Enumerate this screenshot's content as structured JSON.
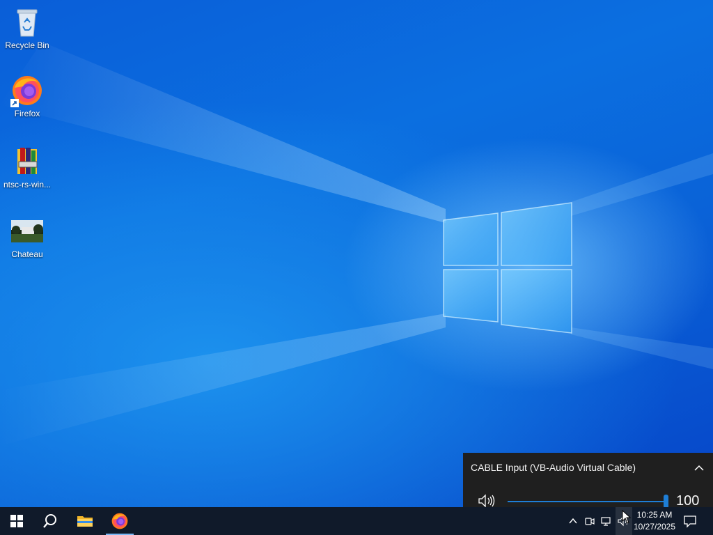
{
  "desktop": {
    "icons": [
      {
        "label": "Recycle Bin",
        "icon": "recycle-bin-icon"
      },
      {
        "label": "Firefox",
        "icon": "firefox-icon"
      },
      {
        "label": "ntsc-rs-win...",
        "icon": "winrar-archive-icon"
      },
      {
        "label": "Chateau",
        "icon": "image-thumbnail-icon"
      }
    ]
  },
  "volume_flyout": {
    "device": "CABLE Input (VB-Audio Virtual Cable)",
    "volume": "100",
    "volume_fraction": 1.0
  },
  "taskbar": {
    "pinned": [
      {
        "name": "start",
        "icon": "windows-logo-icon"
      },
      {
        "name": "search",
        "icon": "search-icon"
      },
      {
        "name": "file-explorer",
        "icon": "folder-icon"
      },
      {
        "name": "firefox",
        "icon": "firefox-icon",
        "active": true
      }
    ],
    "tray": {
      "icons": [
        "chevron-up-icon",
        "meet-now-icon",
        "network-icon",
        "speaker-icon"
      ],
      "time": "10:25 AM",
      "date": "10/27/2025"
    }
  },
  "colors": {
    "accent": "#1e7ed6",
    "taskbar": "#101a2a",
    "flyout": "#1f1f1f"
  }
}
